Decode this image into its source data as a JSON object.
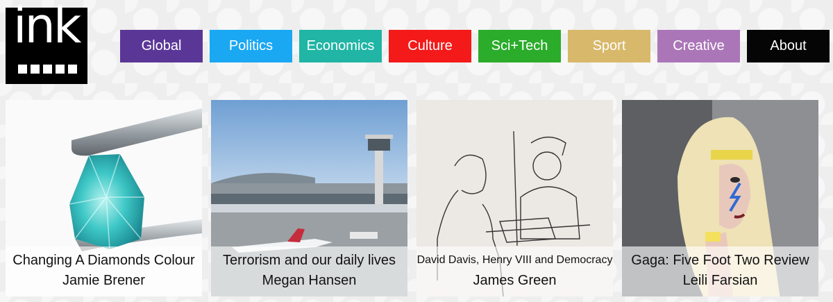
{
  "logo": {
    "text": "ink"
  },
  "nav": [
    {
      "label": "Global",
      "color": "#5a3797"
    },
    {
      "label": "Politics",
      "color": "#1aa8f3"
    },
    {
      "label": "Economics",
      "color": "#20b5a5"
    },
    {
      "label": "Culture",
      "color": "#f41a1a"
    },
    {
      "label": "Sci+Tech",
      "color": "#2bac2b"
    },
    {
      "label": "Sport",
      "color": "#d8b86a"
    },
    {
      "label": "Creative",
      "color": "#ab76b8"
    },
    {
      "label": "About",
      "color": "#050505"
    }
  ],
  "articles": [
    {
      "title": "Changing A Diamonds Colour",
      "author": "Jamie Brener",
      "image": "blue-diamond-image"
    },
    {
      "title": "Terrorism and our daily lives",
      "author": "Megan Hansen",
      "image": "airport-image"
    },
    {
      "title": "David Davis, Henry VIII and Democracy",
      "author": "James Green",
      "image": "cartoon-sketch-image"
    },
    {
      "title": "Gaga: Five Foot Two Review",
      "author": "Leili Farsian",
      "image": "gaga-illustration-image"
    }
  ]
}
